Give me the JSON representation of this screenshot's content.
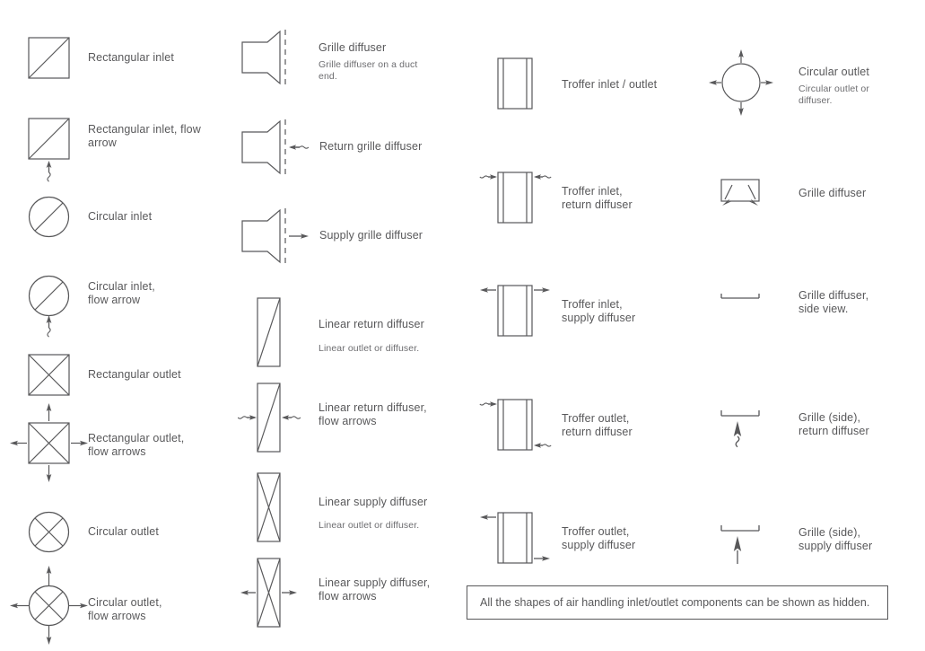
{
  "diagram": {
    "title": "Air handling inlet/outlet components legend",
    "stroke_color": "#58585a",
    "text_color": "#58585a",
    "subtext_color": "#6d6d70",
    "background": "#ffffff"
  },
  "note": {
    "text": "All the shapes of air handling inlet/outlet components can be shown as hidden."
  },
  "columns": [
    {
      "name": "column-1",
      "items": [
        {
          "label": "Rectangular inlet",
          "sub": "",
          "symbol": "rectangular-inlet"
        },
        {
          "label": "Rectangular inlet, flow\narrow",
          "sub": "",
          "symbol": "rectangular-inlet-flow-arrow"
        },
        {
          "label": "Circular inlet",
          "sub": "",
          "symbol": "circular-inlet"
        },
        {
          "label": "Circular inlet,\nflow arrow",
          "sub": "",
          "symbol": "circular-inlet-flow-arrow"
        },
        {
          "label": "Rectangular outlet",
          "sub": "",
          "symbol": "rectangular-outlet"
        },
        {
          "label": "Rectangular outlet,\nflow arrows",
          "sub": "",
          "symbol": "rectangular-outlet-flow-arrows"
        },
        {
          "label": "Circular outlet",
          "sub": "",
          "symbol": "circular-outlet"
        },
        {
          "label": "Circular outlet,\nflow arrows",
          "sub": "",
          "symbol": "circular-outlet-flow-arrows"
        }
      ]
    },
    {
      "name": "column-2",
      "items": [
        {
          "label": "Grille diffuser",
          "sub": "Grille diffuser on a duct\nend.",
          "symbol": "grille-diffuser-duct-end"
        },
        {
          "label": "Return grille diffuser",
          "sub": "",
          "symbol": "return-grille-diffuser"
        },
        {
          "label": "Supply grille diffuser",
          "sub": "",
          "symbol": "supply-grille-diffuser"
        },
        {
          "label": "Linear return diffuser",
          "sub": "Linear outlet or diffuser.",
          "symbol": "linear-return-diffuser"
        },
        {
          "label": "Linear return diffuser,\nflow arrows",
          "sub": "",
          "symbol": "linear-return-diffuser-flow-arrows"
        },
        {
          "label": "Linear supply diffuser",
          "sub": "Linear outlet or diffuser.",
          "symbol": "linear-supply-diffuser"
        },
        {
          "label": "Linear supply diffuser,\nflow arrows",
          "sub": "",
          "symbol": "linear-supply-diffuser-flow-arrows"
        }
      ]
    },
    {
      "name": "column-3",
      "items": [
        {
          "label": "Troffer inlet / outlet",
          "sub": "",
          "symbol": "troffer-inlet-outlet"
        },
        {
          "label": "Troffer inlet,\nreturn diffuser",
          "sub": "",
          "symbol": "troffer-inlet-return-diffuser"
        },
        {
          "label": "Troffer inlet,\nsupply diffuser",
          "sub": "",
          "symbol": "troffer-inlet-supply-diffuser"
        },
        {
          "label": "Troffer outlet,\nreturn diffuser",
          "sub": "",
          "symbol": "troffer-outlet-return-diffuser"
        },
        {
          "label": "Troffer outlet,\nsupply diffuser",
          "sub": "",
          "symbol": "troffer-outlet-supply-diffuser"
        }
      ]
    },
    {
      "name": "column-4",
      "items": [
        {
          "label": "Circular outlet",
          "sub": "Circular outlet or\ndiffuser.",
          "symbol": "circular-outlet-diffuser"
        },
        {
          "label": "Grille diffuser",
          "sub": "",
          "symbol": "grille-diffuser-plan"
        },
        {
          "label": "Grille diffuser,\nside view.",
          "sub": "",
          "symbol": "grille-diffuser-side-view"
        },
        {
          "label": "Grille (side),\nreturn diffuser",
          "sub": "",
          "symbol": "grille-side-return-diffuser"
        },
        {
          "label": "Grille (side),\nsupply diffuser",
          "sub": "",
          "symbol": "grille-side-supply-diffuser"
        }
      ]
    }
  ]
}
